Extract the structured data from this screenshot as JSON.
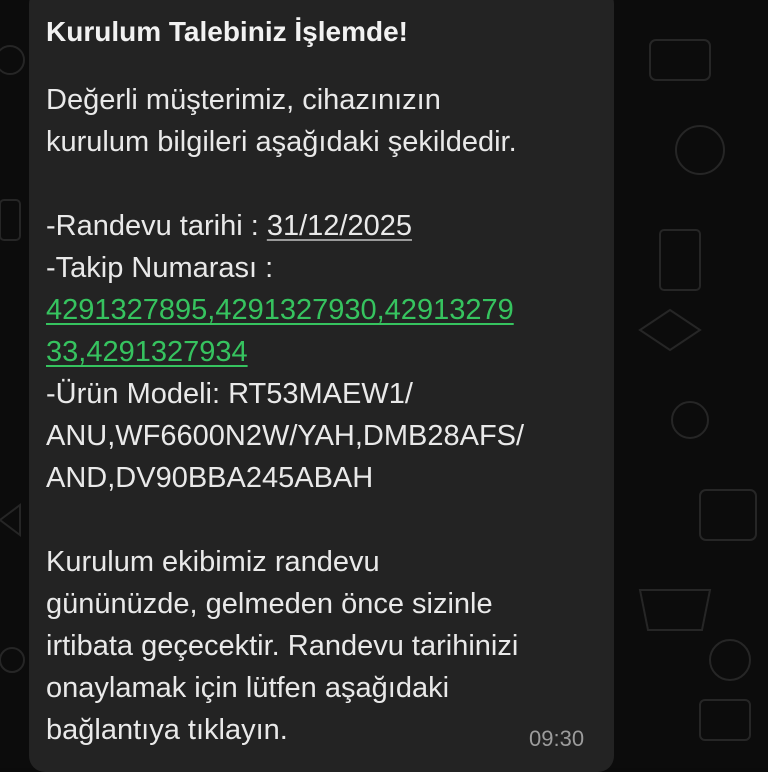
{
  "message": {
    "title": "Kurulum Talebiniz İşlemde!",
    "greeting_line1": "Değerli müşterimiz, cihazınızın",
    "greeting_line2": "kurulum bilgileri aşağıdaki şekildedir.",
    "appointment_label": "-Randevu tarihi : ",
    "appointment_date": "31/12/2025",
    "tracking_label": "-Takip Numarası :",
    "tracking_line1": "4291327895,4291327930,42913279",
    "tracking_line2": "33,4291327934",
    "model_line1": "-Ürün Modeli: RT53MAEW1/",
    "model_line2": "ANU,WF6600N2W/YAH,DMB28AFS/",
    "model_line3": "AND,DV90BBA245ABAH",
    "info_line1": "Kurulum ekibimiz randevu",
    "info_line2": "gününüzde, gelmeden önce sizinle",
    "info_line3": "irtibata geçecektir. Randevu tarihinizi",
    "info_line4": "onaylamak için lütfen aşağıdaki",
    "info_line5": "bağlantıya tıklayın.",
    "time": "09:30"
  },
  "colors": {
    "bubble": "#232323",
    "background": "#0c0c0c",
    "link_green": "#36c35f",
    "text": "#e9e9e9",
    "timestamp": "#9c9c9c"
  }
}
